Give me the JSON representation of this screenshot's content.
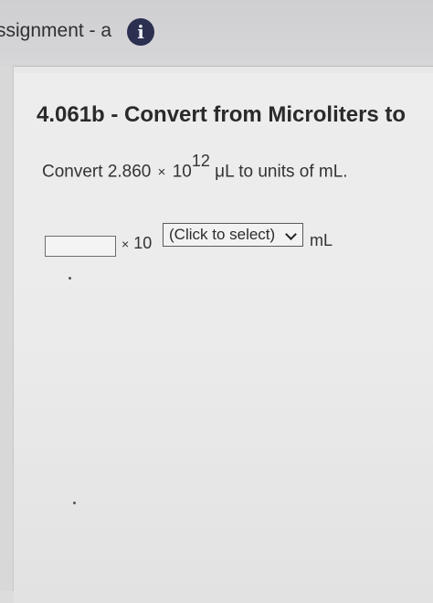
{
  "header": {
    "title": "ssignment - a",
    "info_icon": "i"
  },
  "problem": {
    "title": "4.061b - Convert from Microliters to",
    "question": {
      "prefix": "Convert",
      "mantissa": "2.860",
      "times": "×",
      "base": "10",
      "exponent": "12",
      "unit_from": "μL",
      "suffix": "to units of mL."
    }
  },
  "answer": {
    "input_value": "",
    "times": "×",
    "base": "10",
    "select_label": "(Click to select)",
    "unit": "mL"
  }
}
